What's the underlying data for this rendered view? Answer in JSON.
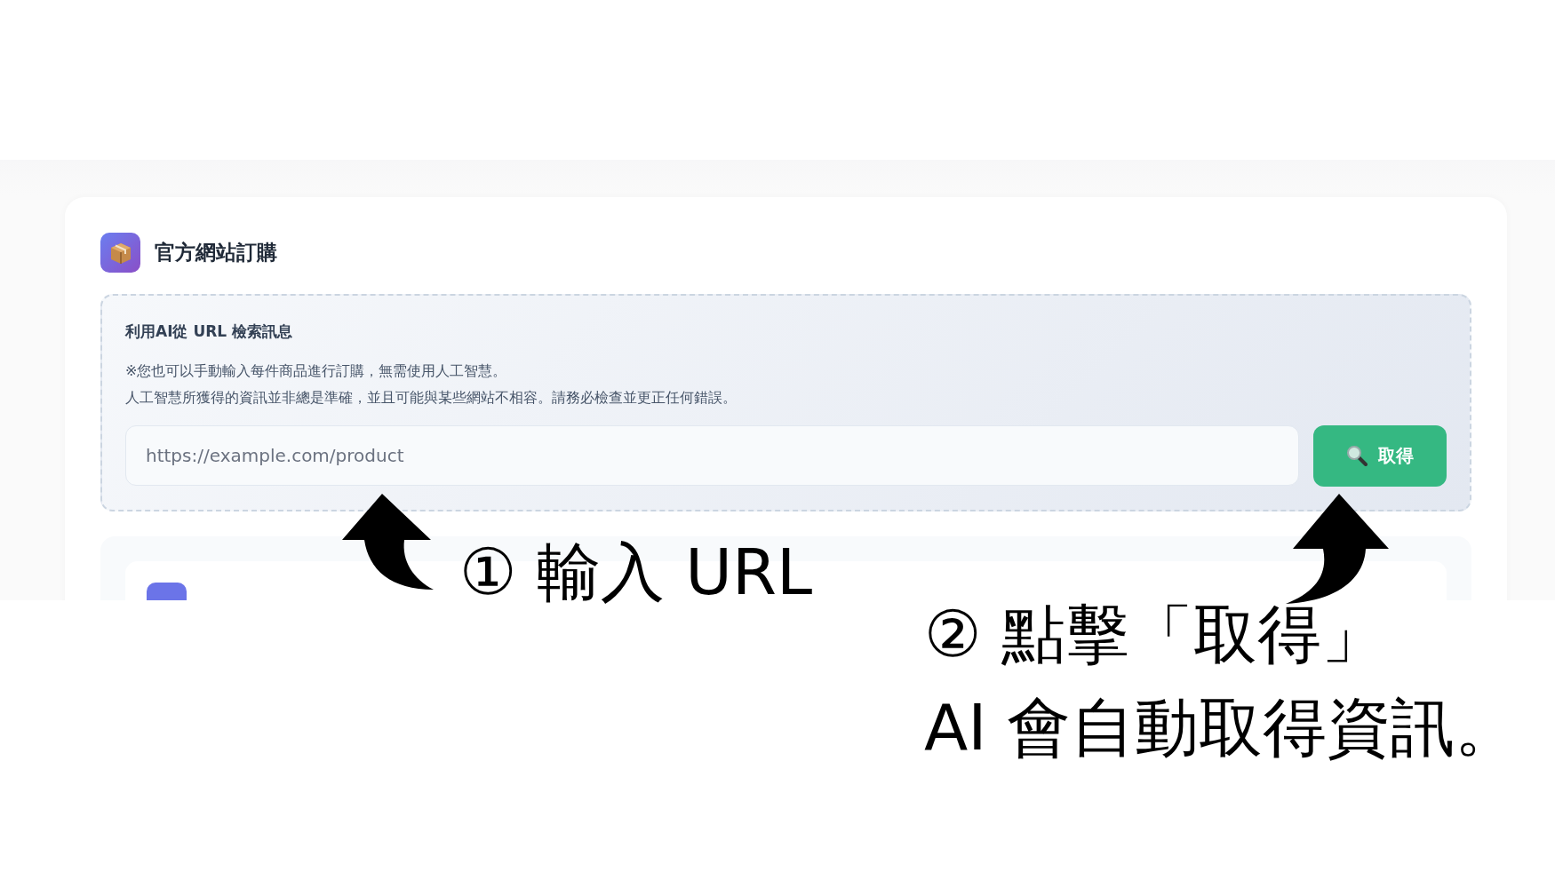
{
  "card": {
    "title": "官方網站訂購",
    "panel": {
      "heading": "利用AI從 URL 檢索訊息",
      "notes": [
        "※您也可以手動輸入每件商品進行訂購，無需使用人工智慧。",
        "人工智慧所獲得的資訊並非總是準確，並且可能與某些網站不相容。請務必檢查並更正任何錯誤。"
      ],
      "url_field": {
        "placeholder": "https://example.com/product"
      },
      "fetch_button": {
        "label": "取得"
      }
    }
  },
  "annotations": [
    "① 輸入 URL",
    "② 點擊「取得」",
    "AI 會自動取得資訊。"
  ]
}
